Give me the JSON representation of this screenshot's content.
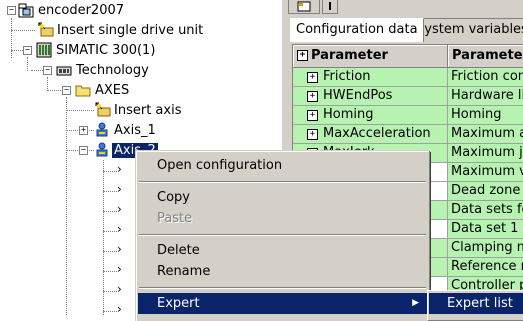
{
  "tree": {
    "root": "encoder2007",
    "insert_drive": "Insert single drive unit",
    "station": "SIMATIC 300(1)",
    "technology": "Technology",
    "axes": "AXES",
    "insert_axis": "Insert axis",
    "axis1": "Axis_1",
    "axis2": "Axis_2"
  },
  "tabs": [
    {
      "label": "Configuration data",
      "active": true
    },
    {
      "label": "System variables",
      "active": false
    }
  ],
  "table": {
    "headers": [
      "Parameter",
      "Parameter"
    ],
    "rows": [
      {
        "name": "Friction",
        "desc": "Friction com",
        "expandable": true,
        "green_desc": true
      },
      {
        "name": "HWEndPos",
        "desc": "Hardware lin",
        "expandable": true,
        "green_desc": true
      },
      {
        "name": "Homing",
        "desc": "Homing",
        "expandable": true,
        "green_desc": true
      },
      {
        "name": "MaxAcceleration",
        "desc": "Maximum ac",
        "expandable": true,
        "green_desc": true
      },
      {
        "name": "MaxJerk",
        "desc": "Maximum je",
        "expandable": true,
        "green_desc": true
      },
      {
        "name": "",
        "desc": "Maximum ve",
        "expandable": false,
        "green_desc": true
      },
      {
        "name": "",
        "desc": "Dead zone c",
        "expandable": false,
        "green_desc": true
      },
      {
        "name": "s",
        "desc": "Data sets fo",
        "expandable": false,
        "green_desc": true
      },
      {
        "name": "",
        "desc": "Data set 1",
        "expandable": false,
        "green_desc": true
      },
      {
        "name": "orin",
        "desc": "Clamping m",
        "expandable": false,
        "green_desc": true
      },
      {
        "name": "mic",
        "desc": "Reference m",
        "expandable": false,
        "green_desc": true
      },
      {
        "name": "",
        "desc": "Controller pa",
        "expandable": false,
        "green_desc": true
      }
    ]
  },
  "context_menu": {
    "open_configuration": "Open configuration",
    "copy": "Copy",
    "paste": "Paste",
    "delete": "Delete",
    "rename": "Rename",
    "expert": "Expert"
  },
  "submenu": {
    "expert_list": "Expert list"
  },
  "colors": {
    "selection": "#0a246a",
    "cell_green": "#b6f3b0",
    "face": "#d4d0c8"
  }
}
